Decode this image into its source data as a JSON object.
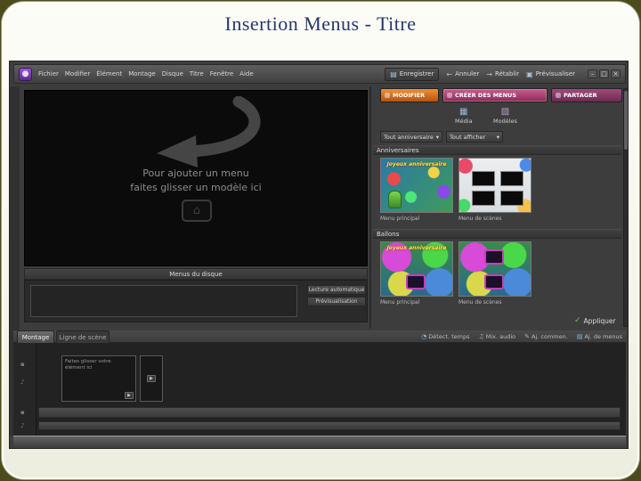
{
  "slide": {
    "title": "Insertion Menus - Titre"
  },
  "icons": {
    "save": "▤",
    "undo": "←",
    "redo": "→",
    "preview": "▣",
    "minimize": "–",
    "maximize": "□",
    "close": "×",
    "media": "▦",
    "templates": "▧",
    "dropdown": "▾",
    "check": "✓",
    "home": "⌂",
    "speaker": "▶",
    "tool_time": "◔",
    "tool_audio": "♫",
    "tool_comment": "✎",
    "tool_menus": "▤",
    "track_video": "▪",
    "track_audio": "♪"
  },
  "app": {
    "menubar": {
      "items": [
        "Fichier",
        "Modifier",
        "Élément",
        "Montage",
        "Disque",
        "Titre",
        "Fenêtre",
        "Aide"
      ],
      "actions": {
        "save": "Enregistrer",
        "undo": "Annuler",
        "redo": "Rétablir",
        "preview": "Prévisualiser"
      }
    },
    "tabs": {
      "modify": "MODIFIER",
      "create": "CRÉER DES MENUS",
      "share": "PARTAGER"
    },
    "preview": {
      "hint_line1": "Pour ajouter un menu",
      "hint_line2": "faites glisser un modèle ici"
    },
    "panel": {
      "media_button": "Média",
      "templates_button": "Modèles",
      "filter_dropdown": "Tout anniversaire",
      "view_dropdown": "Tout afficher",
      "sections": [
        {
          "name": "Anniversaires",
          "templates": [
            {
              "label": "Menu principal"
            },
            {
              "label": "Menu de scènes"
            }
          ]
        },
        {
          "name": "Ballons",
          "templates": [
            {
              "label": "Menu principal"
            },
            {
              "label": "Menu de scènes"
            }
          ]
        }
      ],
      "thumbnail_text": "Joyeux anniversaire",
      "apply_button": "Appliquer"
    },
    "disc_menus": {
      "title": "Menus du disque",
      "auto_play_button": "Lecture automatique",
      "preview_button": "Prévisualisation"
    },
    "timeline": {
      "timeline_tab": "Montage",
      "sceneline_tab": "Ligne de scène",
      "tools": [
        "Détect. temps",
        "Mix. audio",
        "Aj. commen.",
        "Aj. de menus"
      ],
      "clip_hint": "Faites glisser votre élément ici"
    },
    "colors": {
      "tab_orange": "#e0761f",
      "tab_magenta": "#b0487c",
      "tab_purple": "#8a3060",
      "apply_green": "#72c14e",
      "title_navy": "#26366b"
    }
  }
}
